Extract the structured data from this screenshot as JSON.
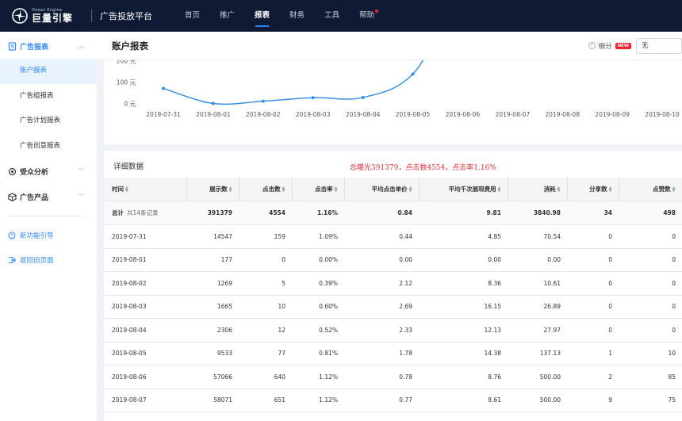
{
  "topbar": {
    "logo_en": "Ocean Engine",
    "logo_cn": "巨量引擎",
    "platform_title": "广告投放平台",
    "nav": [
      {
        "label": "首页"
      },
      {
        "label": "推广"
      },
      {
        "label": "报表",
        "active": true
      },
      {
        "label": "财务"
      },
      {
        "label": "工具"
      },
      {
        "label": "帮助",
        "dot": true
      }
    ]
  },
  "sidebar": {
    "groups": [
      {
        "label": "广告报表",
        "icon": "report-icon",
        "open": true,
        "items": [
          {
            "label": "账户报表",
            "active": true
          },
          {
            "label": "广告组报表"
          },
          {
            "label": "广告计划报表"
          },
          {
            "label": "广告创意报表"
          }
        ]
      },
      {
        "label": "受众分析",
        "icon": "audience-icon",
        "open": false
      },
      {
        "label": "广告产品",
        "icon": "product-icon",
        "open": false
      }
    ],
    "links": [
      {
        "label": "新功能引导",
        "icon": "guide-icon"
      },
      {
        "label": "返回旧页面",
        "icon": "back-icon"
      }
    ]
  },
  "header": {
    "title": "账户报表",
    "detail_label": "细分",
    "new_badge": "NEW",
    "select_value": "无"
  },
  "chart_data": {
    "type": "line",
    "x": [
      "2019-07-31",
      "2019-08-01",
      "2019-08-02",
      "2019-08-03",
      "2019-08-04",
      "2019-08-05",
      "2019-08-06",
      "2019-08-07",
      "2019-08-08",
      "2019-08-09",
      "2019-08-10"
    ],
    "yticks": [
      "0 元",
      "100 元",
      "200 元"
    ],
    "ylim": [
      0,
      200
    ],
    "series": [
      {
        "values": [
          70.54,
          0,
          10.61,
          26.89,
          27.97,
          137.13,
          500,
          500,
          null,
          null,
          null
        ]
      }
    ],
    "color": "#3a8fe0"
  },
  "table": {
    "title": "详细数据",
    "annotation": "总曝光391379，点击数4554，点击率1.16%",
    "columns": [
      "时间",
      "展示数",
      "点击数",
      "点击率",
      "平均点击单价",
      "平均千次展现费用",
      "消耗",
      "分享数",
      "点赞数"
    ],
    "sortable": [
      true,
      true,
      true,
      true,
      true,
      true,
      true,
      true,
      true
    ],
    "total": {
      "label": "总计",
      "note": "共14条记录",
      "cells": [
        "391379",
        "4554",
        "1.16%",
        "0.84",
        "9.81",
        "3840.98",
        "34",
        "498"
      ]
    },
    "rows": [
      [
        "2019-07-31",
        "14547",
        "159",
        "1.09%",
        "0.44",
        "4.85",
        "70.54",
        "0",
        "0"
      ],
      [
        "2019-08-01",
        "177",
        "0",
        "0.00%",
        "0.00",
        "0.00",
        "0.00",
        "0",
        "0"
      ],
      [
        "2019-08-02",
        "1269",
        "5",
        "0.39%",
        "2.12",
        "8.36",
        "10.61",
        "0",
        "0"
      ],
      [
        "2019-08-03",
        "1665",
        "10",
        "0.60%",
        "2.69",
        "16.15",
        "26.89",
        "0",
        "0"
      ],
      [
        "2019-08-04",
        "2306",
        "12",
        "0.52%",
        "2.33",
        "12.13",
        "27.97",
        "0",
        "0"
      ],
      [
        "2019-08-05",
        "9533",
        "77",
        "0.81%",
        "1.78",
        "14.38",
        "137.13",
        "1",
        "10"
      ],
      [
        "2019-08-06",
        "57066",
        "640",
        "1.12%",
        "0.78",
        "8.76",
        "500.00",
        "2",
        "85"
      ],
      [
        "2019-08-07",
        "58071",
        "651",
        "1.12%",
        "0.77",
        "8.61",
        "500.00",
        "9",
        "75"
      ]
    ]
  }
}
